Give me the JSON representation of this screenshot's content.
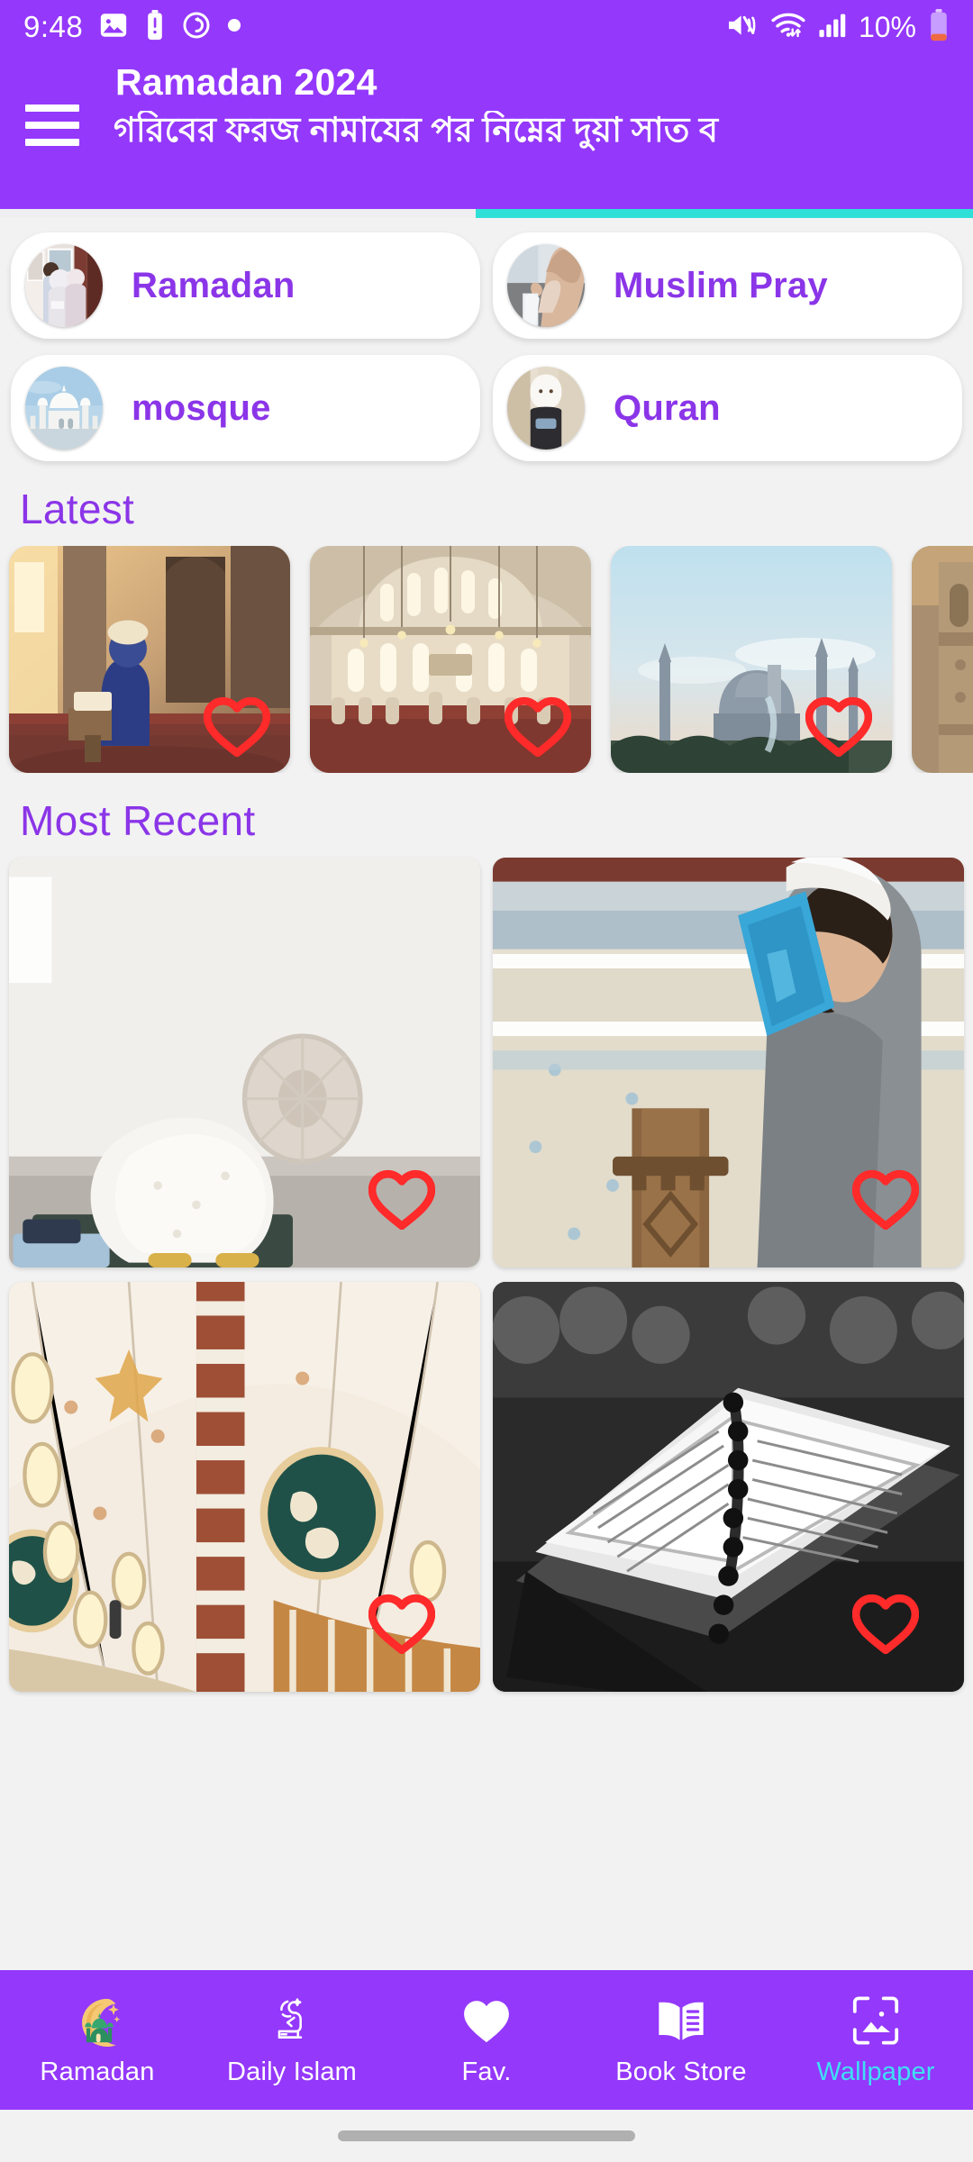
{
  "status_bar": {
    "time": "9:48",
    "battery_percent": "10%",
    "left_icons": [
      "image-icon",
      "battery-alert-icon",
      "sync-circle-icon",
      "dot-icon"
    ],
    "right_icons": [
      "mute-vibrate-icon",
      "wifi-transfer-icon",
      "signal-bars-icon",
      "battery-low-icon"
    ]
  },
  "app_bar": {
    "menu_icon": "hamburger-menu-icon",
    "title": "Ramadan 2024",
    "marquee_text": "গরিবের ফরজ নামাযের পর নিম্নের দুয়া সাত ব",
    "background_color": "#9438fb",
    "indicator_color": "#2fe0d8"
  },
  "categories": [
    {
      "label": "Ramadan",
      "thumb": "ramadan-women-thumb"
    },
    {
      "label": "Muslim Pray",
      "thumb": "praying-woman-thumb"
    },
    {
      "label": "mosque",
      "thumb": "mosque-dome-thumb"
    },
    {
      "label": "Quran",
      "thumb": "quran-woman-thumb"
    }
  ],
  "sections": {
    "latest_title": "Latest",
    "recent_title": "Most Recent"
  },
  "latest_items": [
    {
      "name": "man-praying-at-quran-stand",
      "fav_icon": "heart-outline-icon"
    },
    {
      "name": "mosque-interior-chandeliers",
      "fav_icon": "heart-outline-icon"
    },
    {
      "name": "blue-mosque-at-dusk",
      "fav_icon": "heart-outline-icon"
    },
    {
      "name": "minaret-tower",
      "fav_icon": "heart-outline-icon"
    }
  ],
  "recent_items": [
    {
      "name": "woman-in-sujud-prayer",
      "fav_icon": "heart-outline-icon"
    },
    {
      "name": "man-holding-quran",
      "fav_icon": "heart-outline-icon"
    },
    {
      "name": "mosque-dome-ceiling",
      "fav_icon": "heart-outline-icon"
    },
    {
      "name": "open-quran-with-beads",
      "fav_icon": "heart-outline-icon"
    }
  ],
  "bottom_nav": {
    "active": "Wallpaper",
    "active_color": "#3fdff5",
    "items": [
      {
        "label": "Ramadan",
        "icon": "crescent-mosque-icon"
      },
      {
        "label": "Daily Islam",
        "icon": "praying-person-icon"
      },
      {
        "label": "Fav.",
        "icon": "heart-filled-icon"
      },
      {
        "label": "Book Store",
        "icon": "open-book-icon"
      },
      {
        "label": "Wallpaper",
        "icon": "wallpaper-image-icon"
      }
    ]
  },
  "colors": {
    "primary_purple": "#9438fb",
    "label_purple": "#8b35e8",
    "heart_red": "#ff2a2a",
    "page_background": "#f2f2f2"
  }
}
